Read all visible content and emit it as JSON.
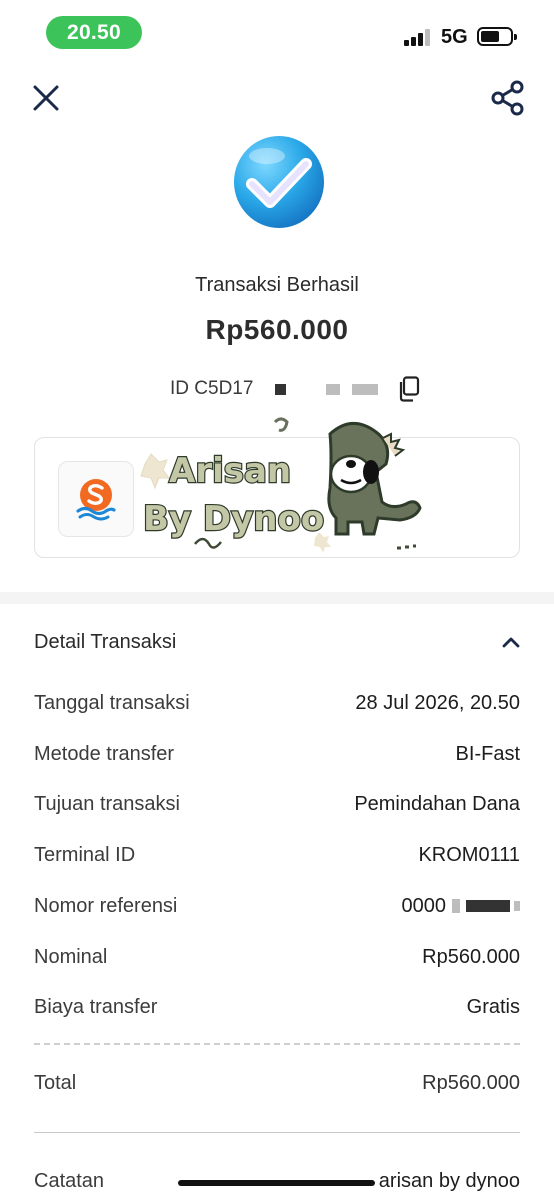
{
  "status_bar": {
    "time": "20.50",
    "network": "5G",
    "time_pill_color": "#3cc35a"
  },
  "nav": {
    "close_icon": "close-icon",
    "share_icon": "share-icon"
  },
  "header": {
    "status_title": "Transaksi Berhasil",
    "amount": "Rp560.000",
    "transaction_id_prefix": "ID C5D17",
    "success_icon": "check-badge-icon"
  },
  "recipient": {
    "bank_logo_icon": "bank-logo-icon",
    "watermark": {
      "line1": "Arisan",
      "line2": "By Dynoo"
    }
  },
  "details": {
    "title": "Detail Transaksi",
    "rows": [
      {
        "label": "Tanggal transaksi",
        "value": "28 Jul 2026, 20.50"
      },
      {
        "label": "Metode transfer",
        "value": "BI-Fast"
      },
      {
        "label": "Tujuan transaksi",
        "value": "Pemindahan Dana"
      },
      {
        "label": "Terminal ID",
        "value": "KROM0111"
      },
      {
        "label": "Nomor referensi",
        "value": "0000"
      },
      {
        "label": "Nominal",
        "value": "Rp560.000"
      },
      {
        "label": "Biaya transfer",
        "value": "Gratis"
      }
    ],
    "total": {
      "label": "Total",
      "value": "Rp560.000"
    },
    "note": {
      "label": "Catatan",
      "value": "arisan by dynoo"
    }
  },
  "colors": {
    "accent": "#1b2a4a",
    "check_blue": "#2aa8e8"
  }
}
